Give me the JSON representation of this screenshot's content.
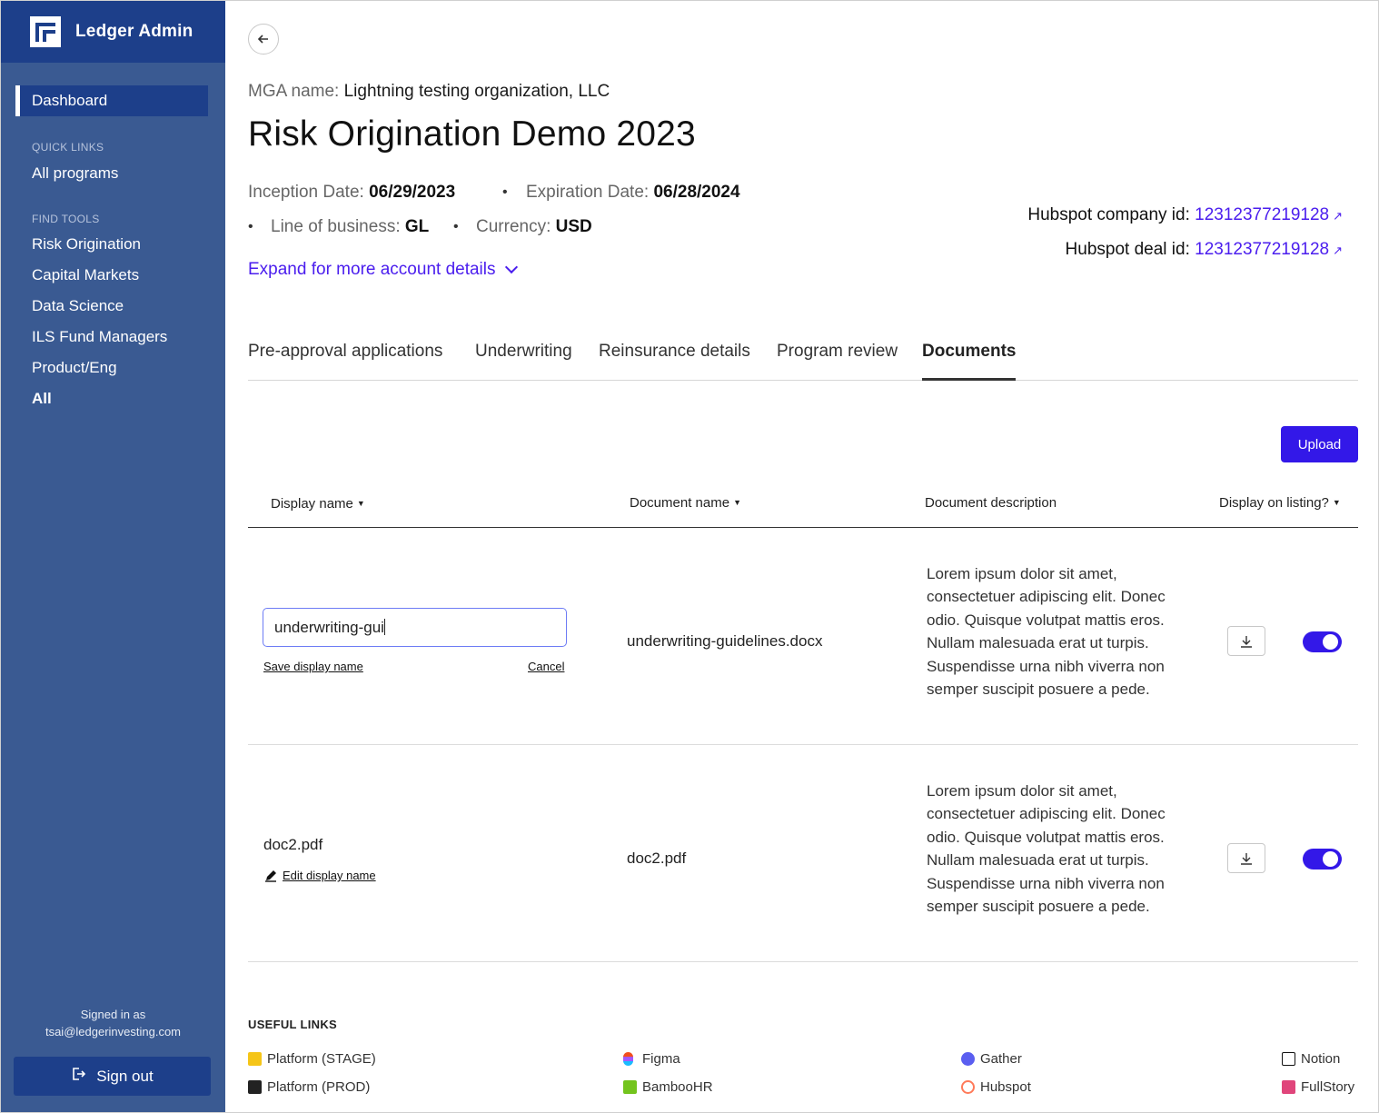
{
  "app": {
    "name": "Ledger Admin"
  },
  "sidebar": {
    "active": "Dashboard",
    "quick_links_title": "QUICK LINKS",
    "quick_links": [
      "All programs"
    ],
    "find_tools_title": "FIND TOOLS",
    "find_tools": [
      "Risk Origination",
      "Capital Markets",
      "Data Science",
      "ILS Fund Managers",
      "Product/Eng",
      "All"
    ],
    "signed_in_label": "Signed in as",
    "signed_in_email": "tsai@ledgerinvesting.com",
    "sign_out": "Sign out"
  },
  "header": {
    "mga_label": "MGA name:",
    "mga_value": "Lightning testing organization, LLC",
    "title": "Risk Origination Demo 2023",
    "inception_label": "Inception Date:",
    "inception_value": "06/29/2023",
    "expiration_label": "Expiration Date:",
    "expiration_value": "06/28/2024",
    "lob_label": "Line of business:",
    "lob_value": "GL",
    "currency_label": "Currency:",
    "currency_value": "USD",
    "expand_label": "Expand for more account details",
    "hubspot_company_label": "Hubspot company id:",
    "hubspot_company_id": "12312377219128",
    "hubspot_deal_label": "Hubspot deal id:",
    "hubspot_deal_id": "12312377219128"
  },
  "tabs": [
    "Pre-approval applications",
    "Underwriting",
    "Reinsurance details",
    "Program review",
    "Documents"
  ],
  "active_tab": "Documents",
  "upload_label": "Upload",
  "table": {
    "columns": [
      "Display name",
      "Document name",
      "Document description",
      "Display on listing?"
    ],
    "rows": [
      {
        "display_name_input": "underwriting-gui",
        "save_label": "Save display name",
        "cancel_label": "Cancel",
        "document_name": "underwriting-guidelines.docx",
        "description": "Lorem ipsum dolor sit amet, consectetuer adipiscing elit. Donec odio. Quisque volutpat mattis eros. Nullam malesuada erat ut turpis. Suspendisse urna nibh viverra non semper suscipit posuere a pede.",
        "display_on_listing": true
      },
      {
        "display_name": "doc2.pdf",
        "edit_label": "Edit display name",
        "document_name": "doc2.pdf",
        "description": "Lorem ipsum dolor sit amet, consectetuer adipiscing elit. Donec odio. Quisque volutpat mattis eros. Nullam malesuada erat ut turpis. Suspendisse urna nibh viverra non semper suscipit posuere a pede.",
        "display_on_listing": true
      }
    ]
  },
  "useful_links": {
    "title": "USEFUL LINKS",
    "items": [
      {
        "label": "Platform (STAGE)",
        "icon": "ledger-stage-icon",
        "color": "#f5c518"
      },
      {
        "label": "Platform (PROD)",
        "icon": "ledger-prod-icon",
        "color": "#222222"
      },
      {
        "label": "Figma",
        "icon": "figma-icon",
        "color": "#f24e1e"
      },
      {
        "label": "BambooHR",
        "icon": "bamboohr-icon",
        "color": "#73c41d"
      },
      {
        "label": "Gather",
        "icon": "gather-icon",
        "color": "#5a5ef0"
      },
      {
        "label": "Hubspot",
        "icon": "hubspot-icon",
        "color": "#ff7a59"
      },
      {
        "label": "Notion",
        "icon": "notion-icon",
        "color": "#111111"
      },
      {
        "label": "FullStory",
        "icon": "fullstory-icon",
        "color": "#e0457b"
      }
    ]
  },
  "colors": {
    "sidebar": "#3a5a92",
    "sidebar_dark": "#1d3f8a",
    "accent": "#3318e8",
    "link": "#4b1eee"
  }
}
